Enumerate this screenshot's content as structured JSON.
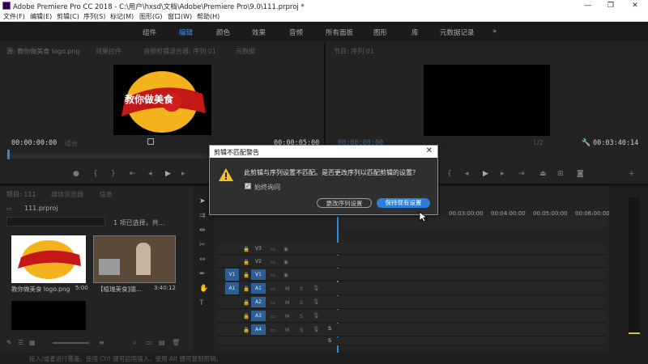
{
  "window": {
    "title": "Adobe Premiere Pro CC 2018 - C:\\用户\\hxsd\\文档\\Adobe\\Premiere Pro\\9.0\\111.prproj *",
    "controls": [
      "—",
      "❐",
      "✕"
    ]
  },
  "menu": [
    "文件(F)",
    "编辑(E)",
    "剪辑(C)",
    "序列(S)",
    "标记(M)",
    "图形(G)",
    "窗口(W)",
    "帮助(H)"
  ],
  "workspaces": {
    "items": [
      "组件",
      "编辑",
      "颜色",
      "效果",
      "音频",
      "所有面板",
      "图形",
      "库",
      "元数据记录"
    ],
    "active": "编辑",
    "more": "»"
  },
  "source_panel": {
    "tabs": [
      "源: 教你做美食 logo.png",
      "效果控件",
      "音频剪辑混合器: 序列 01",
      "元数据"
    ],
    "timecode_left": "00:00:00:00",
    "fit": "适合",
    "timecode_right": "00:00:05:00",
    "logo_text": "教你做美食"
  },
  "program_panel": {
    "tab": "节目: 序列 01",
    "timecode_left": "00:00:00:00",
    "fit": "适合",
    "zoom": "1/2",
    "timecode_right": "00:03:40:14"
  },
  "project_panel": {
    "tabs": [
      "项目: 111",
      "媒体浏览器",
      "信息"
    ],
    "file": "111.prproj",
    "selection": "1 项已选择，共...",
    "items": [
      {
        "name": "教你做美食 logo.png",
        "duration": "5:00"
      },
      {
        "name": "【植瑞美食]德...",
        "duration": "3:40:12"
      }
    ]
  },
  "timeline": {
    "ruler": [
      "00:03:00:00",
      "00:04:00:00",
      "00:05:00:00",
      "00:06:00:00"
    ],
    "video_tracks": [
      "V3",
      "V2",
      "V1"
    ],
    "audio_tracks": [
      "A1",
      "A2",
      "A3",
      "A4"
    ],
    "source_targets": [
      "V1",
      "A1"
    ],
    "solo_markers": [
      "M",
      "S"
    ],
    "meter_labels": [
      "S",
      "S"
    ]
  },
  "status_bar": {
    "text": "拖入/或者进行覆盖，使用 Ctrl 键可启用插入，使用 Alt 键可复制剪辑。"
  },
  "dialog": {
    "title": "剪辑不匹配警告",
    "message": "此剪辑与序列设置不匹配。是否更改序列以匹配剪辑的设置？",
    "checkbox_label": "始终询问",
    "checkbox_checked": true,
    "button_change": "更改序列设置",
    "button_keep": "保持现有设置"
  },
  "colors": {
    "accent": "#2f8ad8",
    "dialog_primary": "#2c7fd8",
    "track_blue": "#2b5f95",
    "warning": "#f2c12e"
  }
}
